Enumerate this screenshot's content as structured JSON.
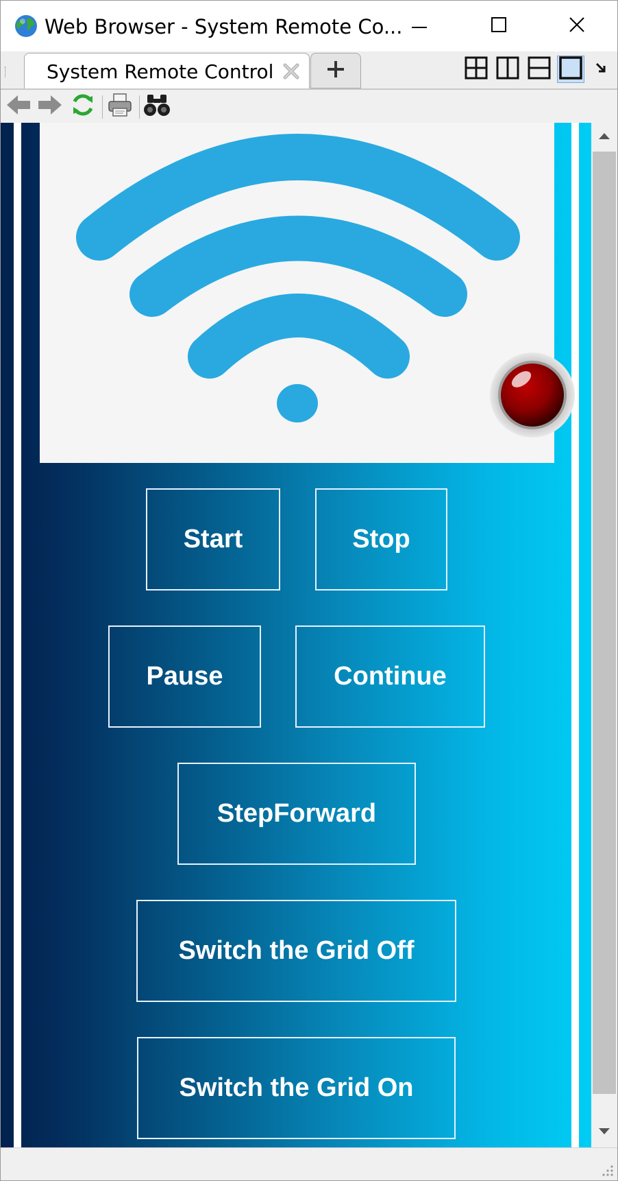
{
  "window": {
    "title": "Web Browser - System Remote Co...",
    "app_icon": "globe-icon",
    "controls": {
      "minimize": "minimize-icon",
      "maximize": "maximize-icon",
      "close": "close-icon"
    }
  },
  "tabs": {
    "items": [
      {
        "label": "System Remote Control",
        "active": true
      }
    ],
    "new_tab_icon": "plus-icon",
    "layout_icons": [
      "grid-4-icon",
      "split-vertical-icon",
      "split-horizontal-icon",
      "single-pane-icon"
    ],
    "active_layout": "single-pane-icon",
    "overflow_icon": "arrow-icon"
  },
  "toolbar": {
    "icons": [
      "back-arrow-icon",
      "forward-arrow-icon",
      "refresh-icon",
      "print-icon",
      "find-binoculars-icon"
    ]
  },
  "page": {
    "hero": {
      "image": "wifi-icon",
      "indicator": "red-status-led",
      "indicator_color": "#8b0000",
      "wifi_color": "#29a9e0"
    },
    "buttons": {
      "start": "Start",
      "stop": "Stop",
      "pause": "Pause",
      "continue": "Continue",
      "step_forward": "StepForward",
      "grid_off": "Switch the Grid Off",
      "grid_on": "Switch the Grid On"
    },
    "gradient_colors": [
      "#02214e",
      "#00cdf5"
    ]
  }
}
